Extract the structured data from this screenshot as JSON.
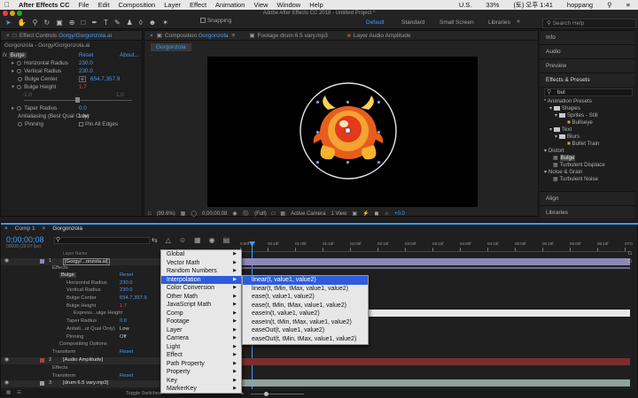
{
  "menubar": {
    "app": "After Effects CC",
    "items": [
      "File",
      "Edit",
      "Composition",
      "Layer",
      "Effect",
      "Animation",
      "View",
      "Window",
      "Help"
    ],
    "right": {
      "flag": "U.S.",
      "battery": "33%",
      "clock": "(토) 오후 1:41",
      "user": "hoppang"
    }
  },
  "window_title": "Adobe After Effects CC 2018 - Untitled Project *",
  "toolbar": {
    "snapping": "Snapping",
    "workspaces": [
      "Default",
      "Standard",
      "Small Screen",
      "Libraries"
    ],
    "search": "Search Help"
  },
  "effect_controls": {
    "tab": "Effect Controls",
    "layer": "Gorgy/Gorgonzola.ai",
    "breadcrumb": "Gorgonzola - Gorgy/Gorgonzola.ai",
    "fx_name": "Bulge",
    "reset": "Reset",
    "about": "About...",
    "props": [
      {
        "label": "Horizontal Radius",
        "value": "230.0"
      },
      {
        "label": "Vertical Radius",
        "value": "230.0"
      },
      {
        "label": "Bulge Center",
        "value": "654.7,357.9"
      },
      {
        "label": "Bulge Height",
        "value": "1.7"
      },
      {
        "label": "Taper Radius",
        "value": "0.0"
      },
      {
        "label": "Antialiasing (Best Qual Only)",
        "value": "Low"
      },
      {
        "label": "Pinning",
        "value": "Pin All Edges"
      }
    ],
    "slider_min": "-1.0",
    "slider_max": "1.0"
  },
  "comp_panel": {
    "tab": "Composition",
    "comp": "Gorgonzola",
    "footage_tab": "Footage drum 6.5 vary.mp3",
    "layer_tab": "Layer Audio Amplitude",
    "breadcrumb": "Gorgonzola",
    "zoom": "(99.6%)",
    "time": "0;00;00;08",
    "res": "(Full)",
    "camera": "Active Camera",
    "view": "1 View",
    "exposure": "+0.0"
  },
  "right_panels": {
    "info": "Info",
    "audio": "Audio",
    "preview": "Preview",
    "effects_presets": "Effects & Presets",
    "search": "bul",
    "tree": [
      "* Animation Presets",
      "Shapes",
      "Sprites - Still",
      "Bullseye",
      "Text",
      "Blurs",
      "Bullet Train",
      "Distort",
      "Bulge",
      "Turbulent Displace",
      "Noise & Grain",
      "Turbulent Noise"
    ],
    "align": "Align",
    "libraries": "Libraries"
  },
  "timeline": {
    "tabs": [
      "Comp 1",
      "Gorgonzola"
    ],
    "time": "0;00;00;08",
    "fps": "00008 (29.97 fps)",
    "col_layer_name": "Layer Name",
    "ruler": [
      "0:00f",
      "00:15f",
      "01:00f",
      "01:15f",
      "02:00f",
      "02:15f",
      "03:00f",
      "03:15f",
      "04:00f",
      "04:15f",
      "05:00f",
      "05:15f",
      "06:00f",
      "06:15f",
      "07:0"
    ],
    "rows": [
      {
        "n": "1",
        "name": "[Gorgy/...onzola.ai]"
      },
      {
        "label": "Effects"
      },
      {
        "label": "Bulge",
        "reset": "Reset"
      },
      {
        "label": "Horizontal Radius",
        "value": "230.0"
      },
      {
        "label": "Vertical Radius",
        "value": "230.0"
      },
      {
        "label": "Bulge Center",
        "value": "654.7,357.9"
      },
      {
        "label": "Bulge Height",
        "value": "1.7"
      },
      {
        "label": "Express...ulge Height"
      },
      {
        "label": "Taper Radius",
        "value": "0.0"
      },
      {
        "label": "Antiali...ut Qual Only)",
        "value": "Low"
      },
      {
        "label": "Pinning",
        "value": "Off"
      },
      {
        "label": "Compositing Options"
      },
      {
        "label": "Transform",
        "reset": "Reset"
      },
      {
        "n": "2",
        "name": "[Audio Amplitude]"
      },
      {
        "label": "Effects"
      },
      {
        "label": "Transform",
        "reset": "Reset"
      },
      {
        "n": "3",
        "name": "[drum 6.5 vary.mp3]"
      }
    ],
    "toggle": "Toggle Switches / Modes"
  },
  "context_menu": {
    "items": [
      "Global",
      "Vector Math",
      "Random Numbers",
      "Interpolation",
      "Color Conversion",
      "Other Math",
      "JavaScript Math",
      "Comp",
      "Footage",
      "Layer",
      "Camera",
      "Light",
      "Effect",
      "Path Property",
      "Property",
      "Key",
      "MarkerKey"
    ],
    "selected": 3,
    "submenu": [
      "linear(t, value1, value2)",
      "linear(t, tMin, tMax, value1, value2)",
      "ease(t, value1, value2)",
      "ease(t, tMin, tMax, value1, value2)",
      "easeIn(t, value1, value2)",
      "easeIn(t, tMin, tMax, value1, value2)",
      "easeOut(t, value1, value2)",
      "easeOut(t, tMin, tMax, value1, value2)"
    ],
    "submenu_selected": 0
  },
  "colors": {
    "accent": "#3e9cf5",
    "menu_select": "#2d5ddc",
    "layer1_bar": "#8c88b6",
    "layer2_bar": "#7a2e2e",
    "layer3_bar": "#8fa39b"
  }
}
